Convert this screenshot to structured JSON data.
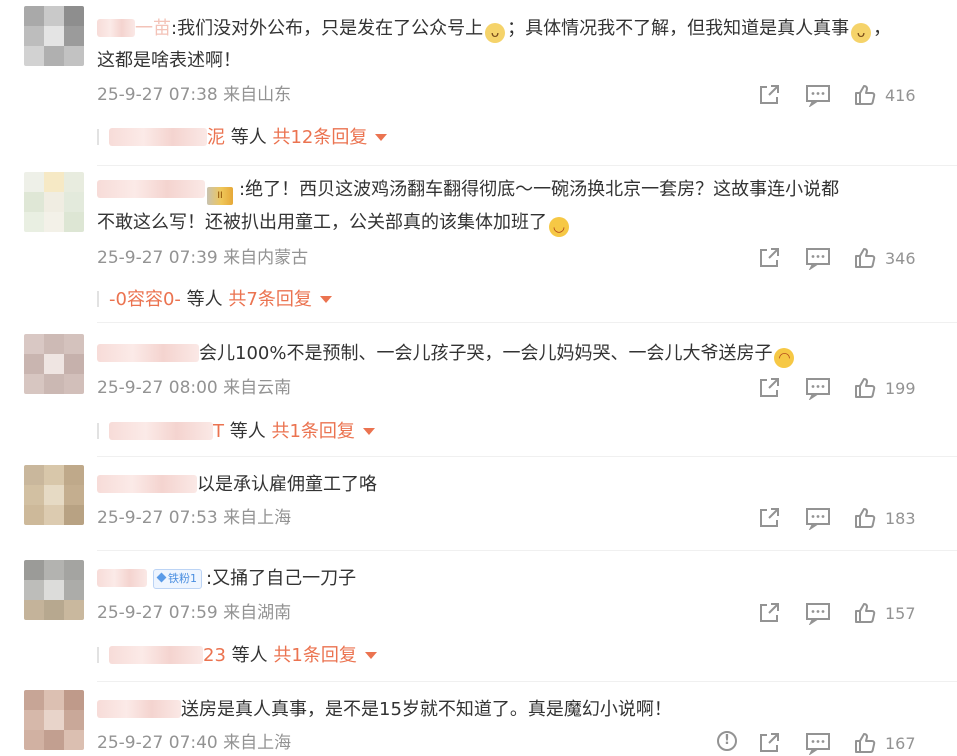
{
  "comments": [
    {
      "prefix": ":",
      "text_line1": "我们没对外公布，只是发在了公众号上",
      "text_line1b": "；具体情况我不了解，但我知道是真人真事",
      "text_line1c": "，",
      "text_line2": "这都是啥表述啊！",
      "name_visible": "一苗",
      "emoji": "cat-emoji",
      "time": "25-9-27 07:38",
      "location": "来自山东",
      "likes": "416",
      "reply": {
        "who_suffix": "泥",
        "etc": "等人",
        "more": "共12条回复"
      }
    },
    {
      "prefix": ":",
      "text_line1": "绝了！西贝这波鸡汤翻车翻得彻底～一碗汤换北京一套房？这故事连小说都",
      "text_line2": "不敢这么写！还被扒出用童工，公关部真的该集体加班了",
      "emoji": "laugh-emoji",
      "time": "25-9-27 07:39",
      "location": "来自内蒙古",
      "likes": "346",
      "reply": {
        "who": "-0容容0-",
        "etc": "等人",
        "more": "共7条回复"
      }
    },
    {
      "text_line1": "会儿100%不是预制、一会儿孩子哭，一会儿妈妈哭、一会儿大爷送房子",
      "emoji": "laugh-cry-emoji",
      "time": "25-9-27 08:00",
      "location": "来自云南",
      "likes": "199",
      "reply": {
        "who_suffix": "T",
        "etc": "等人",
        "more": "共1条回复"
      }
    },
    {
      "text_line1": "以是承认雇佣童工了咯",
      "time": "25-9-27 07:53",
      "location": "来自上海",
      "likes": "183"
    },
    {
      "badge": "铁粉1",
      "text_line1": ":又捅了自己一刀子",
      "time": "25-9-27 07:59",
      "location": "来自湖南",
      "likes": "157",
      "reply": {
        "who_suffix": "23",
        "etc": "等人",
        "more": "共1条回复"
      }
    },
    {
      "text_line1": "送房是真人真事，是不是15岁就不知道了。真是魔幻小说啊！",
      "time": "25-9-27 07:40",
      "location": "来自上海",
      "likes": "167"
    }
  ],
  "icons": {
    "share": "share-icon",
    "comment": "comment-icon",
    "like": "like-icon",
    "report": "report-icon"
  },
  "colors": {
    "accent": "#eb7350",
    "meta": "#939393",
    "text": "#333333"
  }
}
